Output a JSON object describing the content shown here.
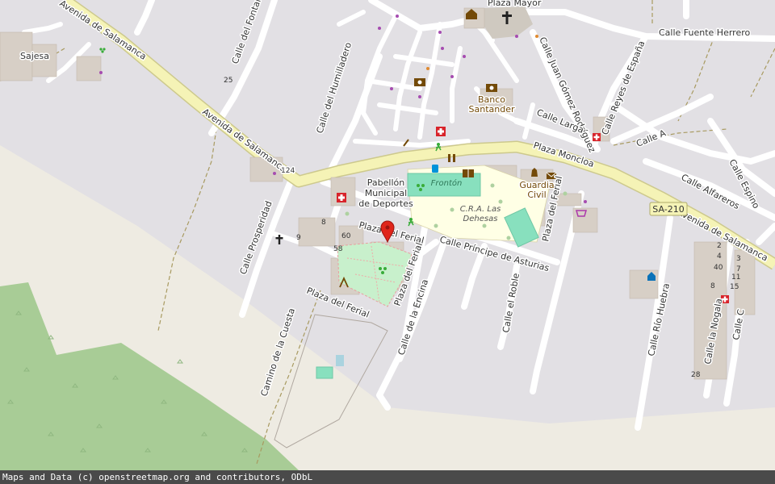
{
  "streets": {
    "avenida_salamanca_w": "Avenida de Salamanca",
    "avenida_salamanca_top": "Avenida de Salamanca",
    "avenida_salamanca_e": "Avenida de Salamanca",
    "calle_fontanal": "Calle del Fontanal",
    "calle_humilladero": "Calle del Humilladero",
    "calle_prosperidad": "Calle Prosperidad",
    "plaza_mayor": "Plaza Mayor",
    "calle_fuente_herrero": "Calle Fuente Herrero",
    "calle_juan_gomez": "Calle Juan Gómez Rodríguez",
    "calle_reyes": "Calle Reyes de España",
    "calle_larga": "Calle Larga",
    "calle_a": "Calle A",
    "plaza_moncloa": "Plaza Moncloa",
    "calle_alfareros": "Calle Alfareros",
    "calle_espino": "Calle Espino",
    "plaza_ferial": "Plaza del Ferial",
    "plaza_ferial_top": "Plaza del Ferial",
    "plaza_ferial_mid": "Plaza del Ferial",
    "plaza_ferial_right": "Plaza del Ferial",
    "calle_principe": "Calle Príncipe de Asturias",
    "calle_roble": "Calle el Roble",
    "calle_encina": "Calle de la Encina",
    "camino_cuesta": "Camino de la Cuesta",
    "calle_rio_huebra": "Calle Río Huebra",
    "calle_nogala": "Calle la Nogala",
    "calle_c": "Calle C",
    "sa210": "SA-210"
  },
  "places": {
    "sajesa": "Sajesa",
    "banco_line1": "Banco",
    "banco_line2": "Santander",
    "pabellon_line1": "Pabellón",
    "pabellon_line2": "Municipal",
    "pabellon_line3": "de Deportes",
    "fronton": "Frontón",
    "guardia_line1": "Guardia",
    "guardia_line2": "Civil",
    "cra_line1": "C.R.A. Las",
    "cra_line2": "Dehesas"
  },
  "house_numbers": {
    "n25": "25",
    "n124": "124",
    "n8": "8",
    "n9": "9",
    "n60": "60",
    "n58": "58",
    "n2": "2",
    "n4": "4",
    "n40": "40",
    "n3": "3",
    "n7": "7",
    "n11": "11",
    "n15": "15",
    "n8b": "8",
    "n28": "28"
  },
  "attribution": "Maps and Data (c) openstreetmap.org and contributors, ODbL",
  "colors": {
    "background": "#e2e0e4",
    "forest": "#a8cc96",
    "farmland": "#eeebe2",
    "main_road": "#f5f3b6",
    "main_road_casing": "#cdc98d",
    "street": "#ffffff",
    "building": "#d7cfc6",
    "park": "#c8f0cc",
    "sports_pitch": "#88e0be",
    "school": "#ffffe5",
    "marker": "#e0251b",
    "pharmacy": "#d8232a"
  },
  "icons": {
    "church": "church-icon",
    "town_hall": "town-hall-icon",
    "bank": "bank-icon",
    "pharmacy": "pharmacy-icon",
    "library": "library-icon",
    "sports": "sports-icon",
    "bus": "bus-stop-icon",
    "post": "post-office-icon",
    "police": "police-icon",
    "shop": "shop-icon",
    "playground": "playground-icon",
    "marker": "location-marker-icon"
  }
}
